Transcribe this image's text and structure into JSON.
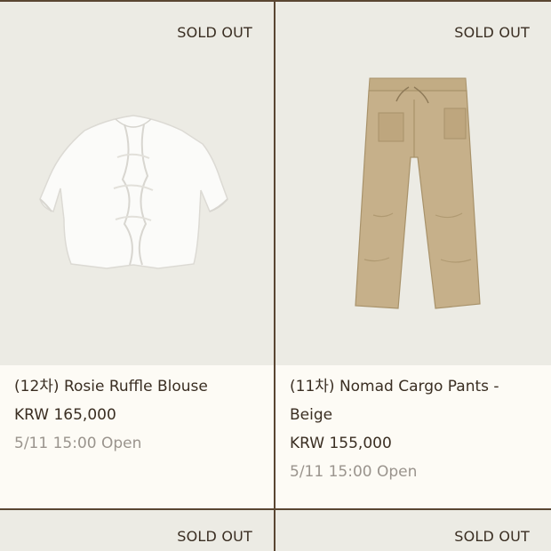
{
  "products": [
    {
      "sold_out": "SOLD OUT",
      "title": "(12차) Rosie Ruffle Blouse",
      "price": "KRW 165,000",
      "open": "5/11 15:00 Open",
      "image_icon": "white-ruffle-blouse"
    },
    {
      "sold_out": "SOLD OUT",
      "title_line1": "(11차) Nomad Cargo Pants -",
      "title_line2": "Beige",
      "price": "KRW 155,000",
      "open": "5/11 15:00 Open",
      "image_icon": "beige-cargo-pants"
    },
    {
      "sold_out": "SOLD OUT"
    },
    {
      "sold_out": "SOLD OUT"
    }
  ],
  "colors": {
    "page_bg": "#fdfbf5",
    "image_bg": "#ecebe4",
    "divider": "#5a4632",
    "text": "#3a2e22",
    "muted": "#9a948d"
  }
}
